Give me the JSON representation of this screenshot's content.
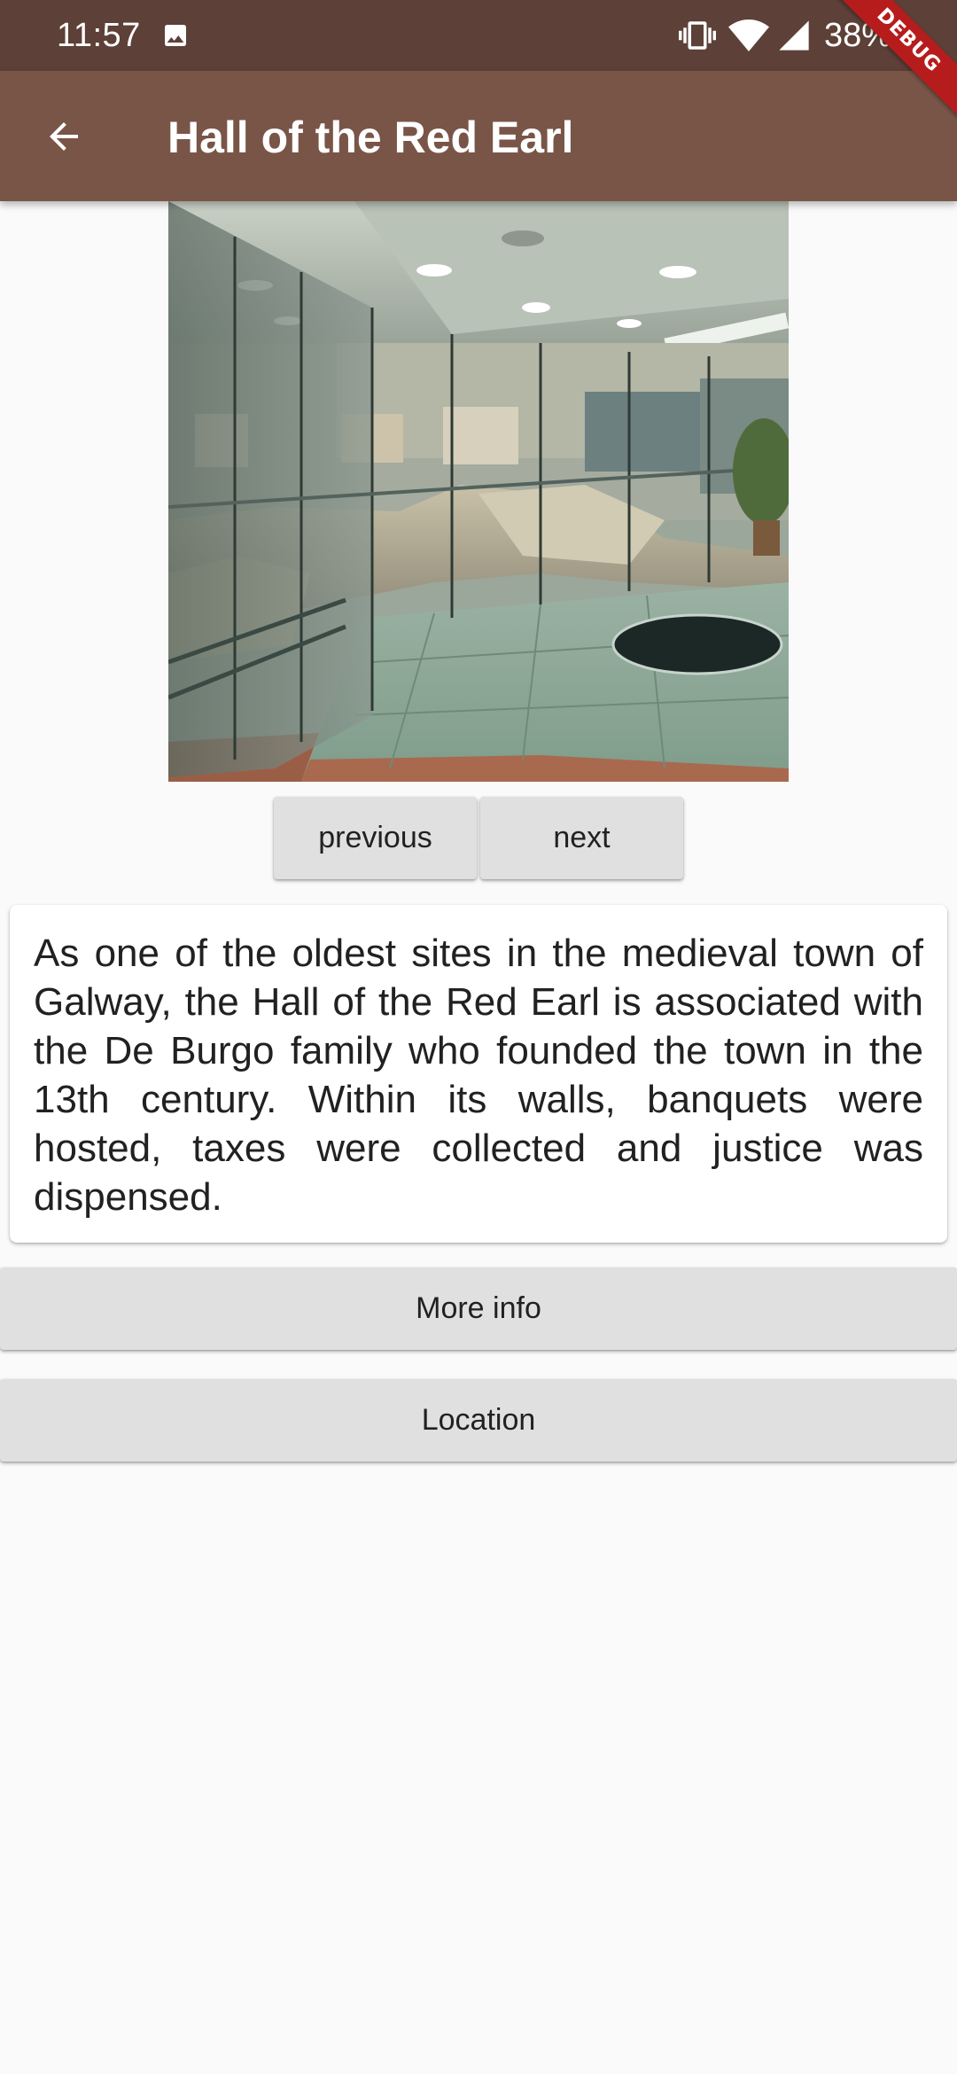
{
  "status_bar": {
    "time": "11:57",
    "battery": "38%",
    "icons": [
      "gallery-icon",
      "vibrate-icon",
      "wifi-icon",
      "signal-icon"
    ]
  },
  "debug_banner": "DEBUG",
  "app_bar": {
    "title": "Hall of the Red Earl",
    "back_icon": "arrow-back-icon"
  },
  "photo": {
    "subject": "Hall of the Red Earl interior"
  },
  "nav": {
    "previous_label": "previous",
    "next_label": "next"
  },
  "description": "As one of the oldest sites in the medieval town of Galway, the Hall of the Red Earl is associated with the De Burgo family who founded the town in the 13th century. Within its walls, banquets were hosted, taxes were collected and justice was dispensed.",
  "actions": {
    "more_info_label": "More info",
    "location_label": "Location"
  },
  "colors": {
    "status_bar": "#5d4037",
    "app_bar": "#795548",
    "background": "#fafafa",
    "button": "#e0e0e0",
    "debug_banner": "#b71c1c"
  }
}
